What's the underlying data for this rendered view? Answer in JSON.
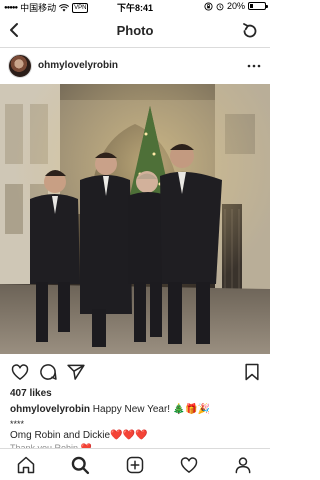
{
  "status_bar": {
    "carrier": "中国移动",
    "vpn": "VPN",
    "time": "下午8:41",
    "battery": "20%",
    "battery_level": 0.2
  },
  "nav": {
    "title": "Photo",
    "back_icon": "chevron-left-icon",
    "refresh_icon": "refresh-icon"
  },
  "post": {
    "username": "ohmylovelyrobin",
    "likes": "407 likes",
    "caption_username": "ohmylovelyrobin",
    "caption_text": "Happy New Year! 🎄🎁🎉",
    "stars": "****",
    "comment1_text": "Omg Robin and Dickie",
    "comment1_hearts": "❤️❤️❤️",
    "comment2_text": "Thank you Robin ❤️"
  },
  "icons": {
    "like": "heart-icon",
    "comment": "comment-icon",
    "share": "send-icon",
    "save": "bookmark-icon",
    "more": "more-icon"
  },
  "tab_bar": {
    "items": [
      "home-icon",
      "search-icon",
      "new-post-icon",
      "activity-icon",
      "profile-icon"
    ]
  }
}
